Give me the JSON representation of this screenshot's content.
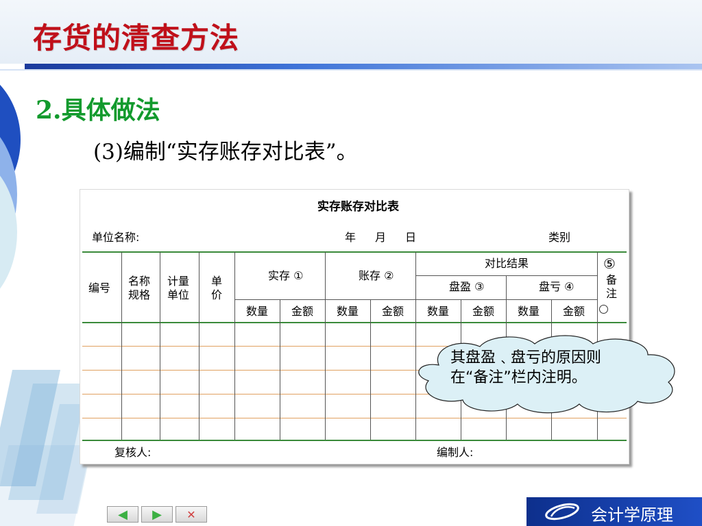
{
  "slide": {
    "title": "存货的清查方法",
    "section_heading": "2.具体做法",
    "subheading": "(3)编制“实存账存对比表”。"
  },
  "table_image": {
    "title": "实存账存对比表",
    "unit_label": "单位名称:",
    "date_year": "年",
    "date_month": "月",
    "date_day": "日",
    "category_label": "类别",
    "headers": {
      "number": "编号",
      "name_spec_1": "名称",
      "name_spec_2": "规格",
      "measure_unit_1": "计量",
      "measure_unit_2": "单位",
      "unit_price_1": "单",
      "unit_price_2": "价",
      "actual": "实存 ①",
      "book": "账存 ②",
      "comparison": "对比结果",
      "surplus": "盘盈 ③",
      "deficit": "盘亏 ④",
      "remark_num": "⑤",
      "remark_1": "备",
      "remark_2": "注",
      "qty": "数量",
      "amount": "金额"
    },
    "reviewer_label": "复核人:",
    "preparer_label": "编制人:"
  },
  "callout": {
    "line1": "其盘盈﹑盘亏的原因则",
    "line2": "在“备注”栏内注明。"
  },
  "nav": {
    "prev_glyph": "◀",
    "next_glyph": "▶",
    "close_glyph": "✕"
  },
  "brand": {
    "label": "会计学原理"
  },
  "colors": {
    "title_red": "#c0101a",
    "heading_green": "#129a2d",
    "brand_blue": "#0d2f8c",
    "nav_green": "#3cb043",
    "nav_red": "#d04040"
  }
}
